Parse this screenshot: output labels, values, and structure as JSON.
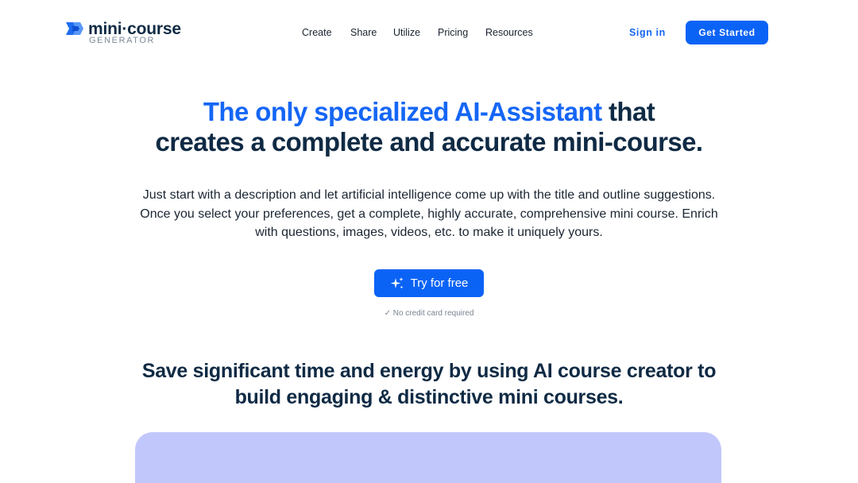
{
  "brand": {
    "name": "mini·course",
    "subtitle": "GENERATOR",
    "accent_color": "#1566f5",
    "logo_icon": "ribbon-mark-icon"
  },
  "nav": {
    "items": [
      "Create",
      "Share",
      "Utilize",
      "Pricing",
      "Resources"
    ],
    "sign_in": "Sign in",
    "get_started": "Get Started"
  },
  "hero": {
    "title_accent": "The only specialized AI-Assistant",
    "title_rest_line1": " that",
    "title_line2": "creates a complete and accurate mini-course.",
    "description": "Just start with a description and let artificial intelligence come up with the title and outline suggestions. Once you select your preferences, get a complete, highly accurate, comprehensive mini course. Enrich with questions, images, videos, etc. to make it uniquely yours.",
    "cta_label": "Try for free",
    "cta_icon": "sparkle-icon",
    "note": "✓ No credit card required"
  },
  "section": {
    "headline": "Save significant time and energy by using AI course creator to build engaging & distinctive mini courses."
  },
  "colors": {
    "primary_button": "#0b63f6",
    "heading": "#0f2a44",
    "panel": "#c2c7fb"
  }
}
